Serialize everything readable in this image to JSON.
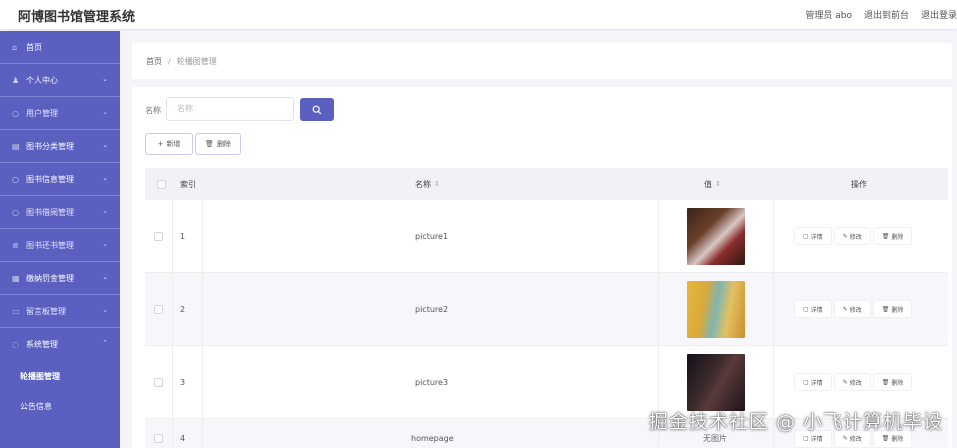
{
  "header": {
    "title": "阿博图书馆管理系统",
    "user": "管理员 abo",
    "to_front": "退出到前台",
    "logout": "退出登录"
  },
  "sidebar": {
    "items": [
      {
        "label": "首页",
        "icon": "home-icon"
      },
      {
        "label": "个人中心",
        "icon": "user-icon"
      },
      {
        "label": "用户管理",
        "icon": "users-icon"
      },
      {
        "label": "图书分类管理",
        "icon": "category-icon"
      },
      {
        "label": "图书信息管理",
        "icon": "book-icon"
      },
      {
        "label": "图书借阅管理",
        "icon": "borrow-icon"
      },
      {
        "label": "图书还书管理",
        "icon": "return-icon"
      },
      {
        "label": "缴纳罚金管理",
        "icon": "fine-icon"
      },
      {
        "label": "留言板管理",
        "icon": "message-icon"
      },
      {
        "label": "系统管理",
        "icon": "system-icon"
      }
    ],
    "subitems": [
      {
        "label": "轮播图管理"
      },
      {
        "label": "公告信息"
      }
    ]
  },
  "breadcrumb": {
    "home": "首页",
    "separator": "/",
    "current": "轮播图管理"
  },
  "search": {
    "label": "名称",
    "placeholder": "名称"
  },
  "toolbar": {
    "add_label": "新增",
    "delete_label": "删除"
  },
  "table": {
    "headers": {
      "index": "索引",
      "name": "名称",
      "value": "值",
      "action": "操作"
    },
    "rows": [
      {
        "index": "1",
        "name": "picture1",
        "value": "image"
      },
      {
        "index": "2",
        "name": "picture2",
        "value": "image"
      },
      {
        "index": "3",
        "name": "picture3",
        "value": "image"
      },
      {
        "index": "4",
        "name": "homepage",
        "value": "无图片"
      }
    ],
    "actions": {
      "detail": "详情",
      "edit": "修改",
      "delete": "删除"
    }
  },
  "watermark": "掘金技术社区 @ 小飞计算机毕设",
  "colors": {
    "sidebar": "#5a5fc0",
    "accent": "#5a5fc0"
  }
}
